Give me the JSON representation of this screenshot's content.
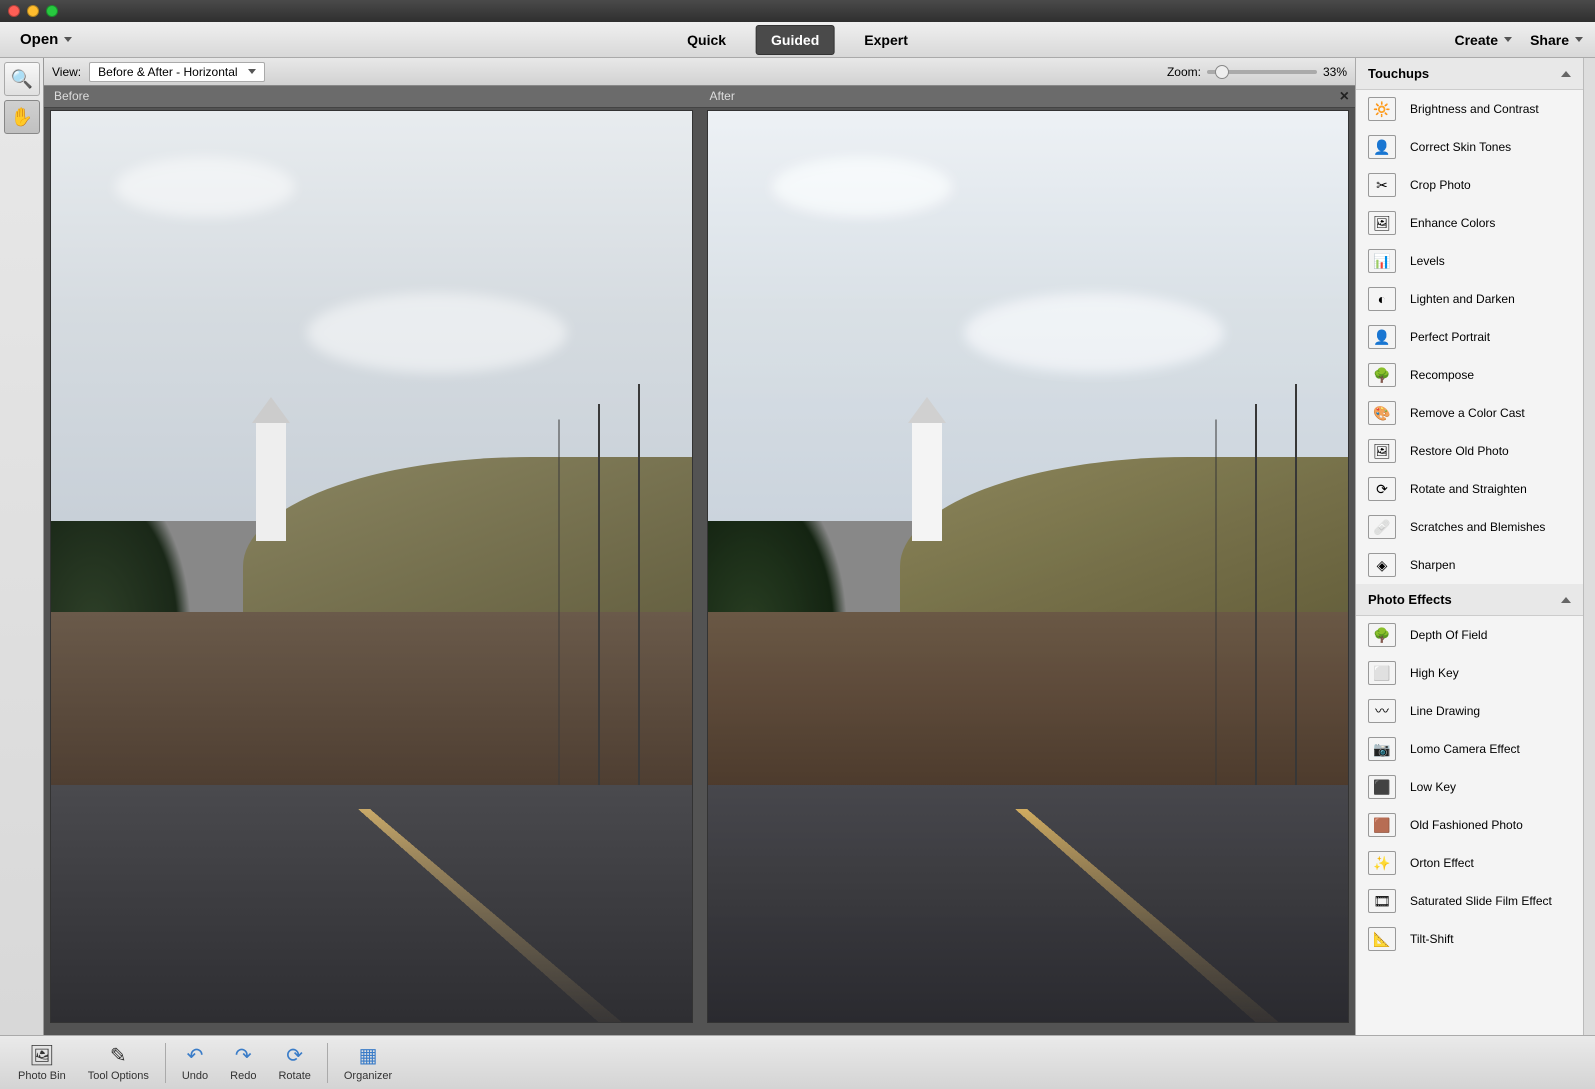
{
  "menubar": {
    "open": "Open",
    "modes": {
      "quick": "Quick",
      "guided": "Guided",
      "expert": "Expert"
    },
    "create": "Create",
    "share": "Share"
  },
  "viewbar": {
    "view_label": "View:",
    "view_value": "Before & After - Horizontal",
    "zoom_label": "Zoom:",
    "zoom_value": "33%"
  },
  "compare": {
    "before": "Before",
    "after": "After"
  },
  "panel": {
    "touchups_header": "Touchups",
    "touchups": [
      "Brightness and Contrast",
      "Correct Skin Tones",
      "Crop Photo",
      "Enhance Colors",
      "Levels",
      "Lighten and Darken",
      "Perfect Portrait",
      "Recompose",
      "Remove a Color Cast",
      "Restore Old Photo",
      "Rotate and Straighten",
      "Scratches and Blemishes",
      "Sharpen"
    ],
    "effects_header": "Photo Effects",
    "effects": [
      "Depth Of Field",
      "High Key",
      "Line Drawing",
      "Lomo Camera Effect",
      "Low Key",
      "Old Fashioned Photo",
      "Orton Effect",
      "Saturated Slide Film Effect",
      "Tilt-Shift"
    ]
  },
  "bottom": {
    "photo_bin": "Photo Bin",
    "tool_options": "Tool Options",
    "undo": "Undo",
    "redo": "Redo",
    "rotate": "Rotate",
    "organizer": "Organizer"
  },
  "icons": {
    "touchups": [
      "🔆",
      "👤",
      "✂",
      "🖼",
      "📊",
      "◐",
      "👤",
      "🌳",
      "🎨",
      "🖼",
      "⟳",
      "🩹",
      "◈"
    ],
    "effects": [
      "🌳",
      "⬜",
      "〰",
      "📷",
      "⬛",
      "🟫",
      "✨",
      "🎞",
      "📐"
    ]
  },
  "colors": {
    "canvas_bg": "#535353",
    "panel_bg": "#f4f4f4",
    "active_tab": "#4a4a4a"
  }
}
